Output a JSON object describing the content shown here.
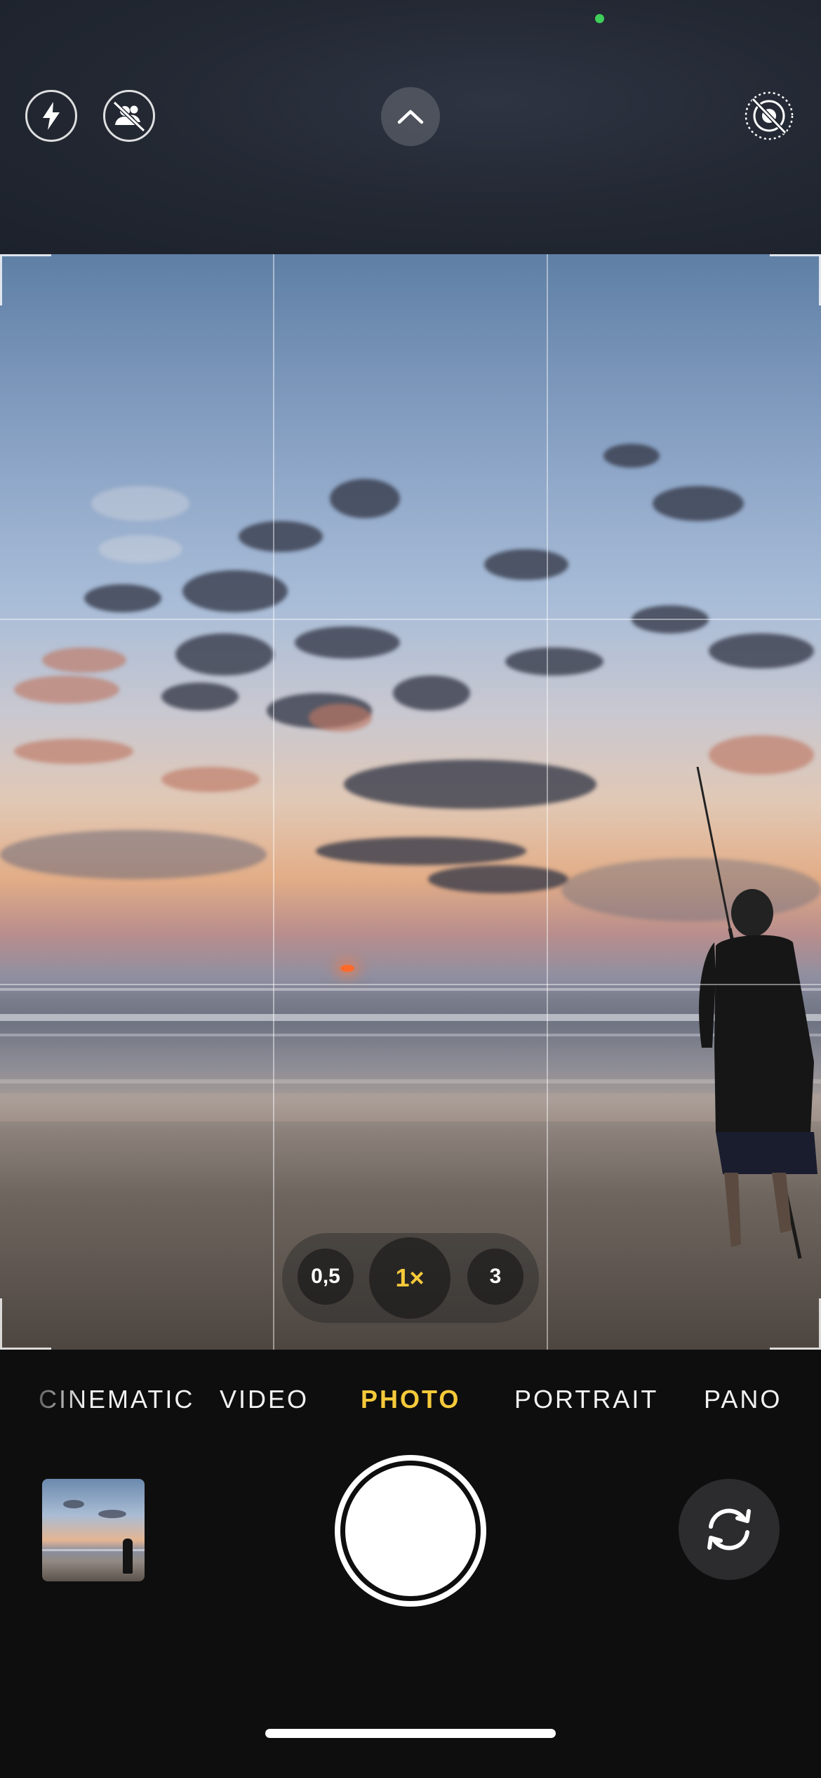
{
  "status": {
    "indicator_color": "#3ecf5a"
  },
  "top_controls": {
    "flash_icon": "flash-icon",
    "people_off_icon": "person-off-icon",
    "chevron_icon": "chevron-up-icon",
    "live_off_icon": "live-photo-off-icon"
  },
  "zoom": {
    "options": [
      "0,5",
      "1×",
      "3"
    ],
    "active_color": "#f5c93a"
  },
  "modes": {
    "items": [
      "CINEMATIC",
      "VIDEO",
      "PHOTO",
      "PORTRAIT",
      "PANO"
    ],
    "active": "PHOTO",
    "active_color": "#f5c93a"
  },
  "bottom_controls": {
    "shutter_icon": "shutter-button",
    "flip_icon": "camera-flip-icon"
  }
}
